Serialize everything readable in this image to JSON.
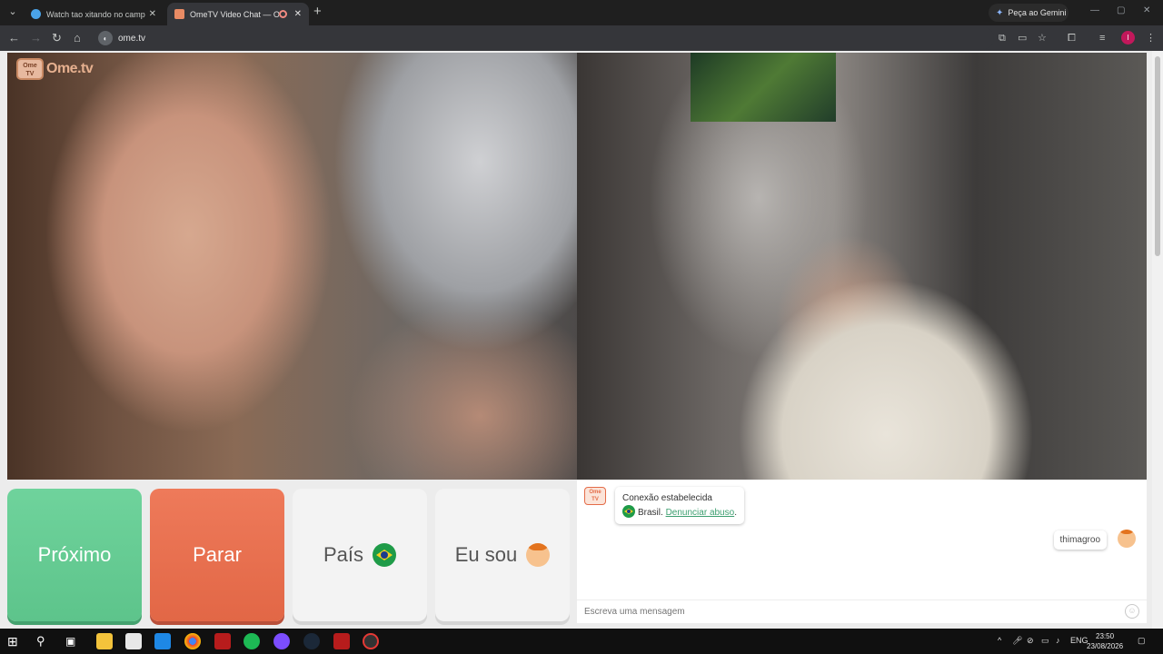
{
  "browser": {
    "tabs": [
      {
        "title": "Watch tao xitando no camp | Sl",
        "active": false
      },
      {
        "title": "OmeTV Video Chat — Ome",
        "active": true
      }
    ],
    "gemini_label": "Peça ao Gemini",
    "url": "ome.tv",
    "profile_initial": "I"
  },
  "site": {
    "logo_text": "Ome.tv",
    "logo_badge": "Ome TV"
  },
  "controls": {
    "next_label": "Próximo",
    "stop_label": "Parar",
    "country_label": "País",
    "gender_label": "Eu sou"
  },
  "chat": {
    "system_icon_text": "Ome TV",
    "system_message": "Conexão estabelecida",
    "country_name": "Brasil.",
    "report_link": "Denunciar abuso",
    "report_suffix": ".",
    "my_message": "thimagroo",
    "input_placeholder": "Escreva uma mensagem"
  },
  "taskbar": {
    "tray_language": "ENG",
    "time": "23:50",
    "date": "23/08/2026"
  },
  "colors": {
    "next": "#5dc48b",
    "stop": "#e26746",
    "link": "#3d9f70"
  }
}
